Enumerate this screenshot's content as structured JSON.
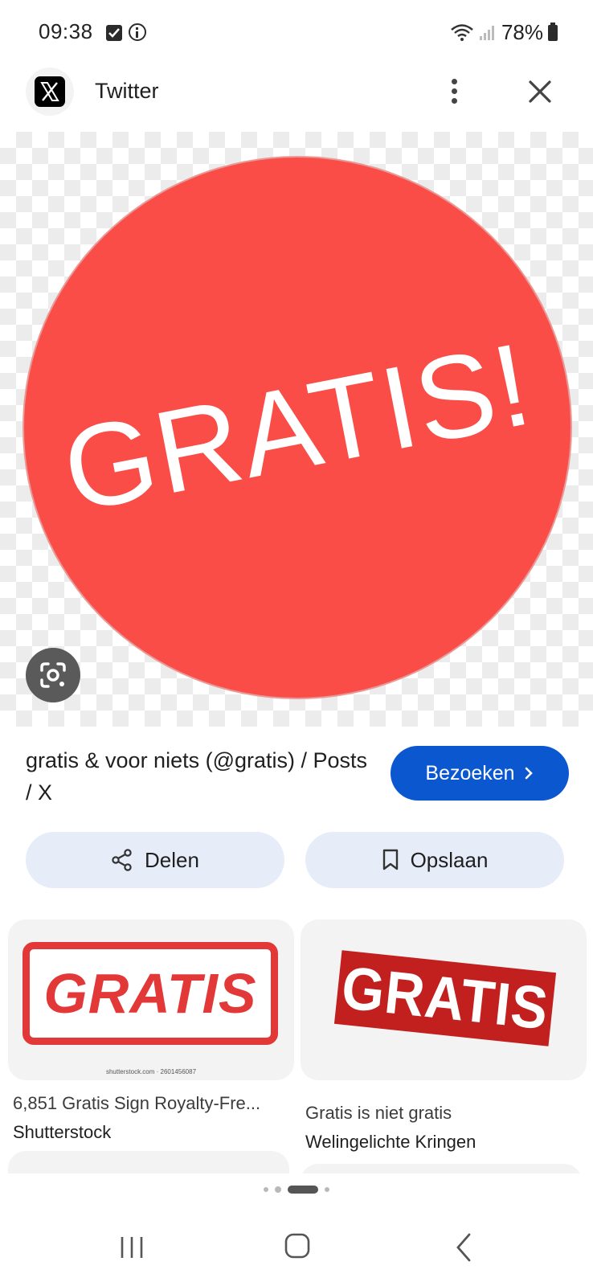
{
  "status_bar": {
    "time": "09:38",
    "battery": "78%"
  },
  "header": {
    "title": "Twitter",
    "logo_letter": "𝕏"
  },
  "main_image": {
    "text": "GRATIS!",
    "circle_color": "#fa4d47"
  },
  "result": {
    "title": "gratis & voor niets (@gratis) / Posts / X",
    "visit_label": "Bezoeken",
    "share_label": "Delen",
    "save_label": "Opslaan"
  },
  "related": [
    {
      "thumb_text": "GRATIS",
      "thumb_source": "shutterstock.com · 2601456087",
      "title": "6,851 Gratis Sign Royalty-Fre...",
      "source": "Shutterstock"
    },
    {
      "thumb_text": "GRATIS",
      "title": "Gratis is niet gratis",
      "source": "Welingelichte Kringen"
    }
  ],
  "colors": {
    "accent": "#0b57d0",
    "action_bg": "#e6edf9"
  },
  "icons": {
    "share": "share-icon",
    "bookmark": "bookmark-icon",
    "lens": "google-lens-icon",
    "close": "close-icon",
    "more": "more-vertical-icon"
  }
}
